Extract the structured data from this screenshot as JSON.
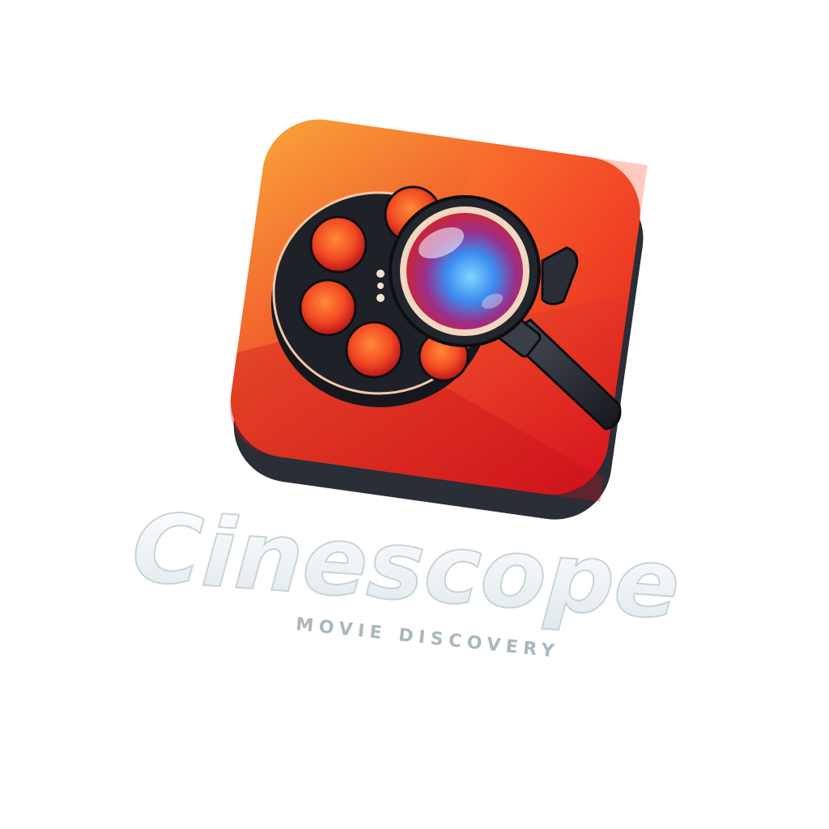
{
  "logo": {
    "wordmark": "Cinescope",
    "tagline": "MOVIE DISCOVERY",
    "icon_name": "film-reel-magnifier-icon"
  },
  "colors": {
    "background": "#ffffff",
    "tile_orange": "#f6902a",
    "tile_red": "#e0201f",
    "tile_base": "#2a2e36",
    "reel_dark": "#1f2128",
    "lens_blue": "#3b8cf0",
    "lens_red": "#d32424",
    "wordmark_fill": "#eef4f6",
    "wordmark_stroke": "#c9d3d8",
    "tagline": "#aab7bf"
  }
}
